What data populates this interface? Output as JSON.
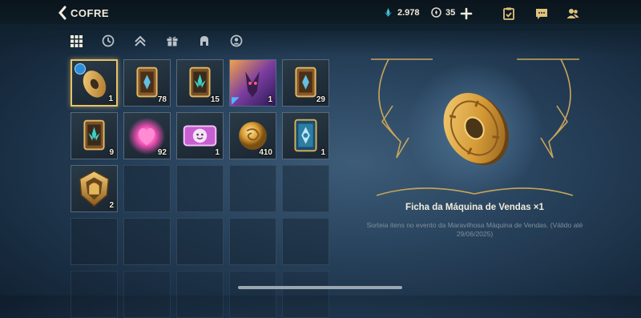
{
  "header": {
    "title": "COFRE"
  },
  "currencies": {
    "blue_essence": "2.978",
    "tokens": "35"
  },
  "icons": {
    "back": "chevron-left-icon",
    "blue_essence": "crystal-icon",
    "tokens": "token-icon",
    "add": "plus-icon",
    "missions": "clipboard-check-icon",
    "chat": "chat-icon",
    "friends": "friends-icon"
  },
  "filters": [
    "grid-icon",
    "clock-icon",
    "chevrons-up-icon",
    "gift-icon",
    "helmet-icon",
    "profile-icon"
  ],
  "items": [
    {
      "type": "coin-token",
      "count": "1",
      "selected": true,
      "badge": true
    },
    {
      "type": "card-gold-blue",
      "count": "78"
    },
    {
      "type": "card-gold-teal",
      "count": "15"
    },
    {
      "type": "skin-art",
      "count": "1"
    },
    {
      "type": "card-gold-blue",
      "count": "29"
    },
    {
      "type": "card-gold-teal",
      "count": "9"
    },
    {
      "type": "pink-essence",
      "count": "92"
    },
    {
      "type": "emote-ticket",
      "count": "1"
    },
    {
      "type": "gold-orb",
      "count": "410"
    },
    {
      "type": "card-blue-frame",
      "count": "1"
    },
    {
      "type": "gold-emblem",
      "count": "2"
    }
  ],
  "empty_slots": 14,
  "detail": {
    "name": "Ficha da Máquina de Vendas ×1",
    "description": "Sorteia itens no evento da Maravilhosa Máquina de Vendas. (Válido até 29/06/2025)"
  },
  "colors": {
    "accent_gold": "#e7c46a",
    "text": "#f2ecdc",
    "muted": "#7f8f9c"
  }
}
